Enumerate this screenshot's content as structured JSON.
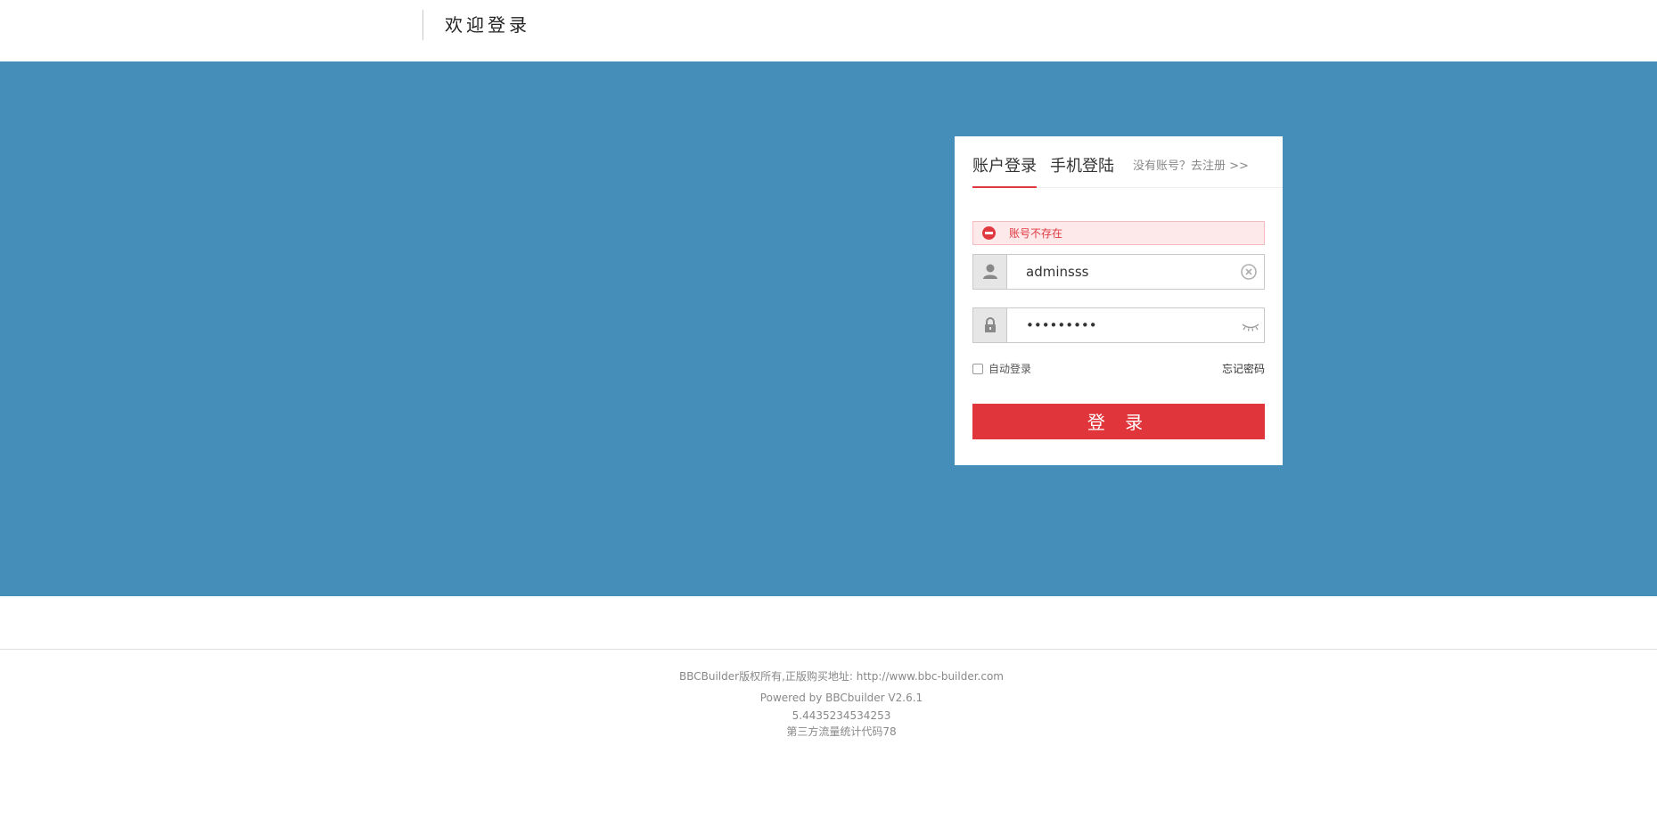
{
  "header": {
    "title": "欢迎登录"
  },
  "login": {
    "tabs": [
      {
        "label": "账户登录",
        "active": true
      },
      {
        "label": "手机登陆",
        "active": false
      }
    ],
    "register_link": "没有账号？去注册 >>",
    "error_message": "账号不存在",
    "username": {
      "value": "adminsss",
      "icon": "user-icon",
      "trailing_icon": "clear-icon"
    },
    "password": {
      "value": "•••••••••",
      "icon": "lock-icon",
      "trailing_icon": "eye-closed-icon"
    },
    "auto_login_label": "自动登录",
    "auto_login_checked": false,
    "forgot_password": "忘记密码",
    "submit_label": "登 录"
  },
  "footer": {
    "line1": "BBCBuilder版权所有,正版购买地址: http://www.bbc-builder.com",
    "line2": "Powered by BBCbuilder V2.6.1",
    "line3": "5.4435234534253",
    "line4": "第三方流量统计代码78"
  },
  "colors": {
    "banner": "#458eb9",
    "accent": "#e0353b",
    "error_bg": "#fde9ea"
  }
}
